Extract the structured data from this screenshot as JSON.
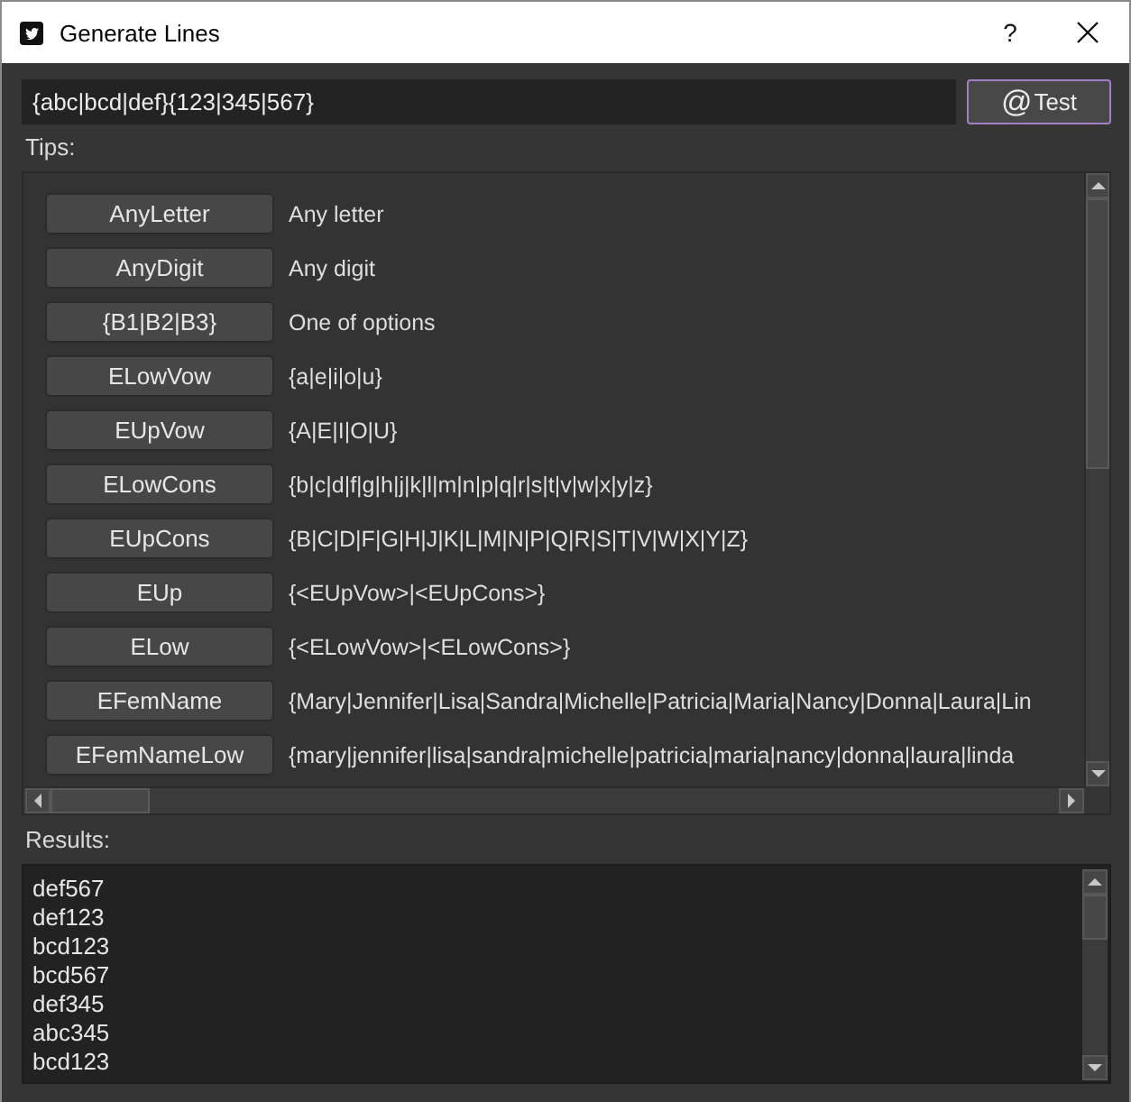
{
  "window": {
    "title": "Generate Lines",
    "help_button": "?"
  },
  "pattern_field": {
    "value": "{abc|bcd|def}{123|345|567}"
  },
  "test_button": {
    "icon": "@",
    "label": "Test",
    "focused": true
  },
  "tips": {
    "label": "Tips:",
    "items": [
      {
        "button": "AnyLetter",
        "description": "Any letter"
      },
      {
        "button": "AnyDigit",
        "description": "Any digit"
      },
      {
        "button": "{B1|B2|B3}",
        "description": "One of options"
      },
      {
        "button": "ELowVow",
        "description": "{a|e|i|o|u}"
      },
      {
        "button": "EUpVow",
        "description": "{A|E|I|O|U}"
      },
      {
        "button": "ELowCons",
        "description": "{b|c|d|f|g|h|j|k|l|m|n|p|q|r|s|t|v|w|x|y|z}"
      },
      {
        "button": "EUpCons",
        "description": "{B|C|D|F|G|H|J|K|L|M|N|P|Q|R|S|T|V|W|X|Y|Z}"
      },
      {
        "button": "EUp",
        "description": "{<EUpVow>|<EUpCons>}"
      },
      {
        "button": "ELow",
        "description": "{<ELowVow>|<ELowCons>}"
      },
      {
        "button": "EFemName",
        "description": "{Mary|Jennifer|Lisa|Sandra|Michelle|Patricia|Maria|Nancy|Donna|Laura|Lin"
      },
      {
        "button": "EFemNameLow",
        "description": "{mary|jennifer|lisa|sandra|michelle|patricia|maria|nancy|donna|laura|linda"
      }
    ]
  },
  "results": {
    "label": "Results:",
    "lines": [
      "def567",
      "def123",
      "bcd123",
      "bcd567",
      "def345",
      "abc345",
      "bcd123"
    ]
  }
}
